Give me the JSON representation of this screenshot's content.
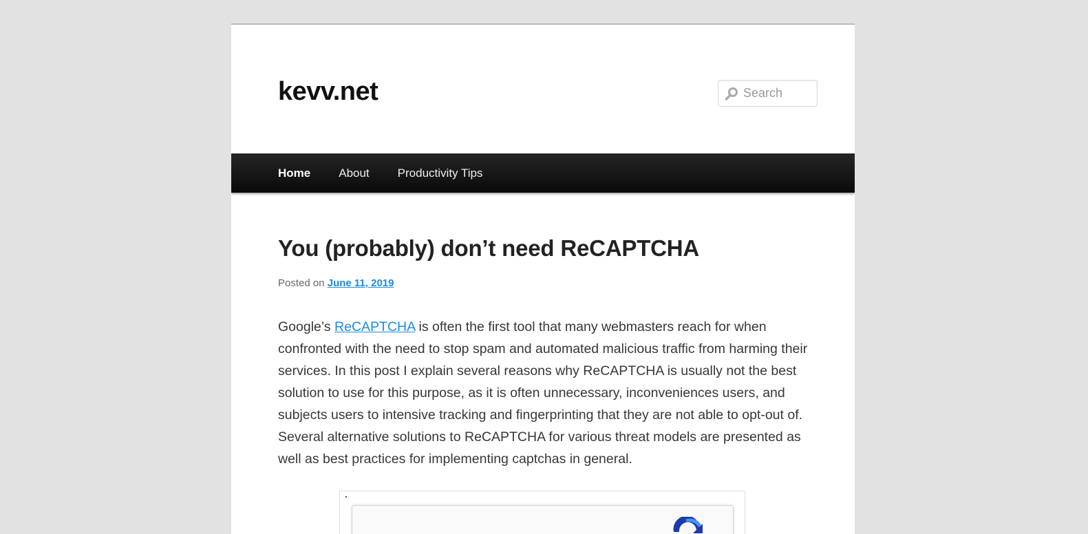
{
  "site": {
    "title": "kevv.net"
  },
  "search": {
    "placeholder": "Search",
    "value": ""
  },
  "nav": {
    "items": [
      {
        "label": "Home",
        "current": true
      },
      {
        "label": "About",
        "current": false
      },
      {
        "label": "Productivity Tips",
        "current": false
      }
    ]
  },
  "post": {
    "title": "You (probably) don’t need ReCAPTCHA",
    "meta_prefix": "Posted on",
    "date": "June 11, 2019",
    "intro_before_link": "Google’s ",
    "link_text": "ReCAPTCHA",
    "intro_after_link": " is often the first tool that many webmasters reach for when confronted with the need to stop spam and automated malicious traffic from harming their services. In this post I explain several reasons why ReCAPTCHA is usually not the best solution to use for this purpose, as it is often unnecessary, inconveniences users, and subjects users to intensive tracking and fingerprinting that they are not able to opt-out of. Several alternative solutions to ReCAPTCHA for various threat models are presented as well as best practices for implementing captchas in general."
  },
  "colors": {
    "link": "#1b8be0",
    "nav_bg": "#111111",
    "page_bg": "#e2e2e2"
  }
}
